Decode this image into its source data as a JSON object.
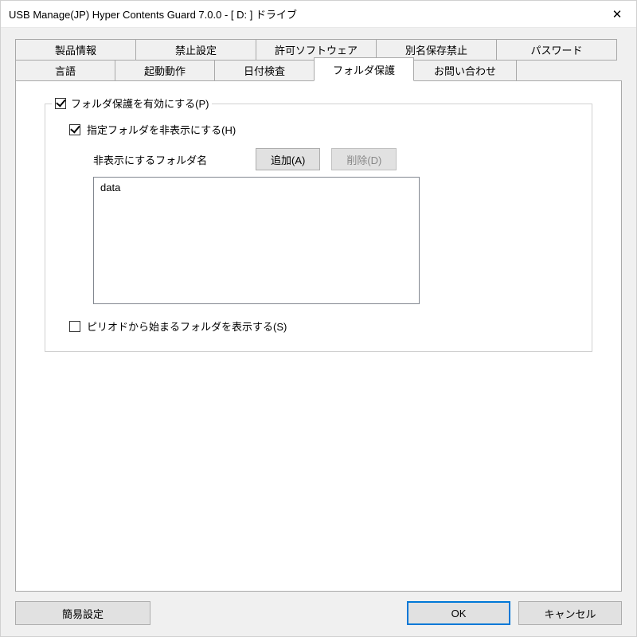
{
  "window": {
    "title": "USB Manage(JP) Hyper Contents Guard 7.0.0  -  [ D: ] ドライブ"
  },
  "tabs": {
    "row1": [
      {
        "label": "製品情報"
      },
      {
        "label": "禁止設定"
      },
      {
        "label": "許可ソフトウェア"
      },
      {
        "label": "別名保存禁止"
      },
      {
        "label": "パスワード"
      }
    ],
    "row2": [
      {
        "label": "言語"
      },
      {
        "label": "起動動作"
      },
      {
        "label": "日付検査"
      },
      {
        "label": "フォルダ保護",
        "active": true
      },
      {
        "label": "お問い合わせ"
      }
    ]
  },
  "panel": {
    "enable_protection_label": "フォルダ保護を有効にする(P)",
    "enable_protection_checked": true,
    "hide_folders_label": "指定フォルダを非表示にする(H)",
    "hide_folders_checked": true,
    "folder_list_label": "非表示にするフォルダ名",
    "add_button": "追加(A)",
    "delete_button": "削除(D)",
    "folders": [
      "data"
    ],
    "show_period_label": "ピリオドから始まるフォルダを表示する(S)",
    "show_period_checked": false
  },
  "buttons": {
    "easy_setup": "簡易設定",
    "ok": "OK",
    "cancel": "キャンセル"
  }
}
